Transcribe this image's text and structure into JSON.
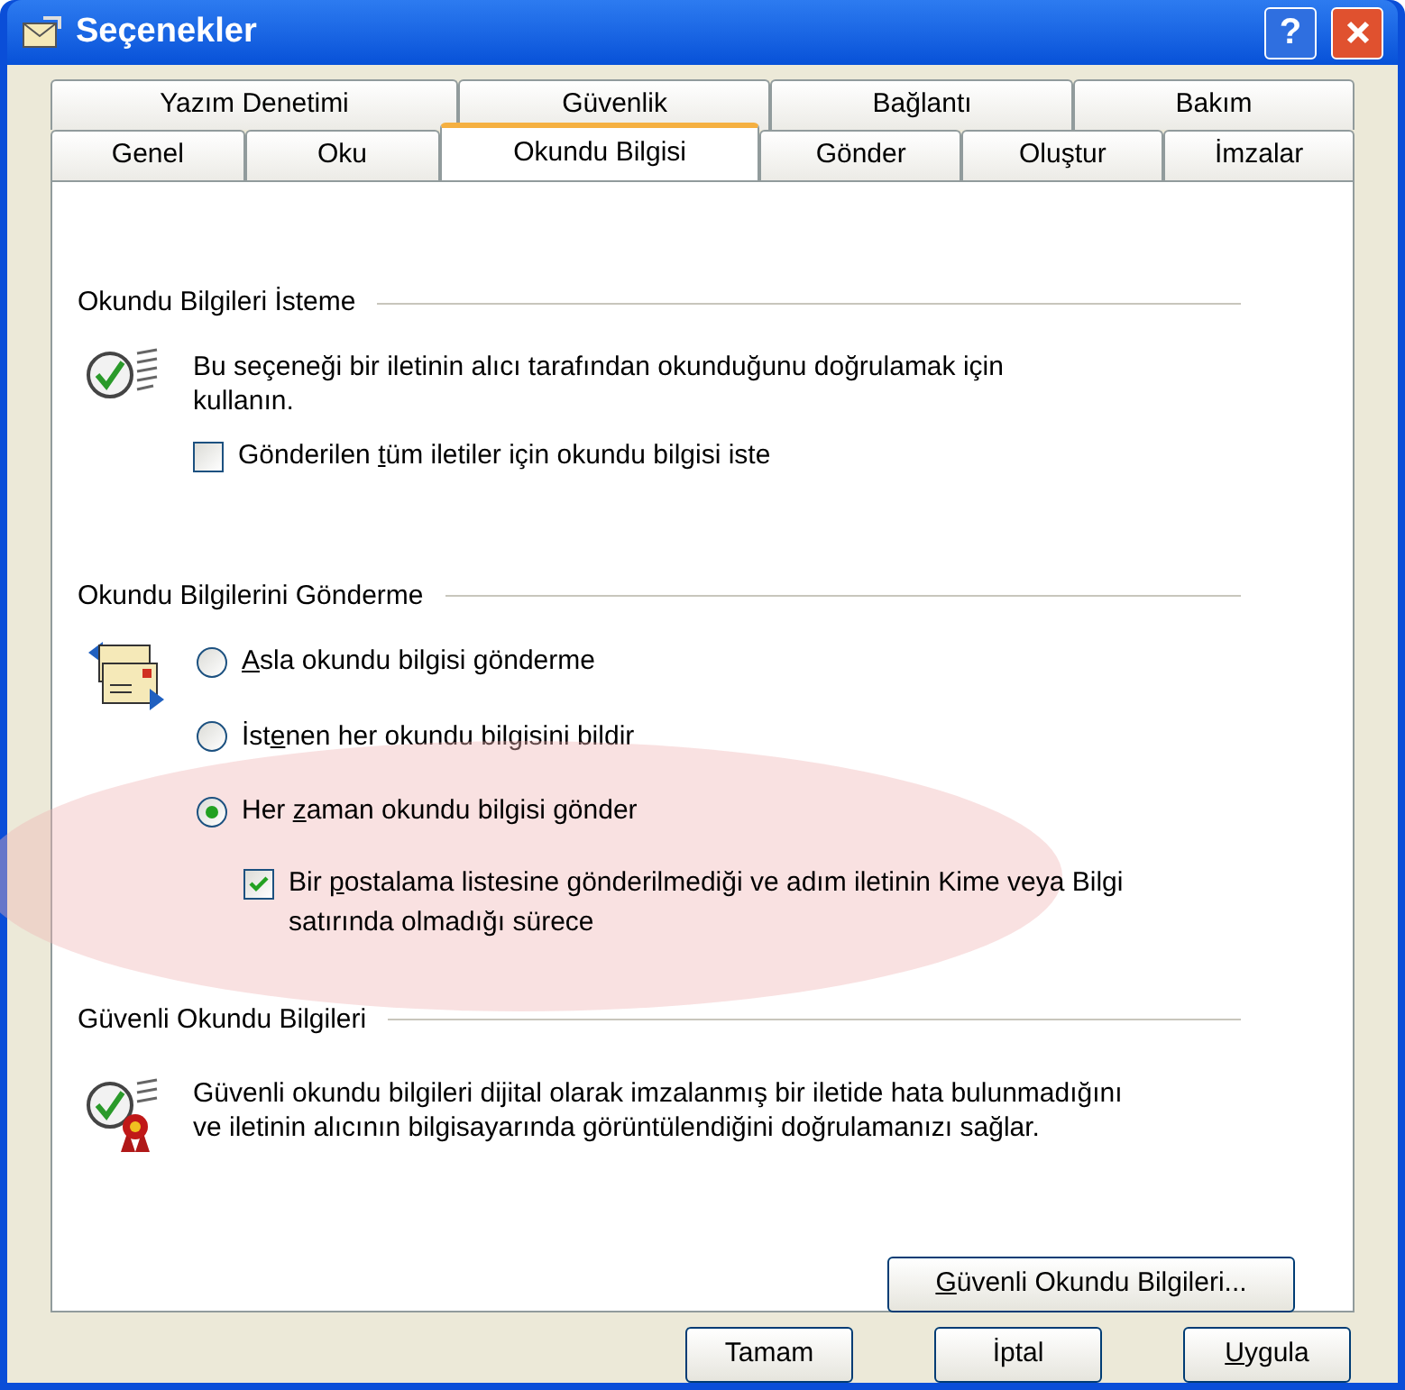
{
  "window": {
    "title": "Seçenekler",
    "help_label": "?"
  },
  "tab_rows": [
    [
      {
        "label": "Yazım Denetimi",
        "selected": false
      },
      {
        "label": "Güvenlik",
        "selected": false
      },
      {
        "label": "Bağlantı",
        "selected": false
      },
      {
        "label": "Bakım",
        "selected": false
      }
    ],
    [
      {
        "label": "Genel",
        "selected": false
      },
      {
        "label": "Oku",
        "selected": false
      },
      {
        "label": "Okundu Bilgisi",
        "selected": true
      },
      {
        "label": "Gönder",
        "selected": false
      },
      {
        "label": "Oluştur",
        "selected": false
      },
      {
        "label": "İmzalar",
        "selected": false
      }
    ]
  ],
  "request": {
    "title": "Okundu Bilgileri İsteme",
    "description": "Bu seçeneği bir iletinin alıcı tarafından okunduğunu doğrulamak için kullanın.",
    "checkbox": {
      "before": "Gönderilen ",
      "key": "t",
      "after": "üm iletiler için okundu bilgisi iste",
      "checked": false
    }
  },
  "send": {
    "title": "Okundu Bilgilerini Gönderme",
    "options": [
      {
        "key": "A",
        "after": "sla okundu bilgisi gönderme",
        "selected": false,
        "highlighted": false
      },
      {
        "before": "İst",
        "key": "e",
        "after": "nen her okundu bilgisini bildir",
        "selected": false,
        "highlighted": false
      },
      {
        "before": "Her ",
        "key": "z",
        "after": "aman okundu bilgisi gönder",
        "selected": true,
        "highlighted": true
      }
    ],
    "checkbox": {
      "before": "Bir ",
      "key": "p",
      "after": "ostalama listesine gönderilmediği ve adım iletinin Kime veya Bilgi satırında olmadığı sürece",
      "checked": true
    }
  },
  "secure": {
    "title": "Güvenli Okundu Bilgileri",
    "description": "Güvenli okundu bilgileri dijital olarak imzalanmış bir iletide hata bulunmadığını ve iletinin alıcının bilgisayarında görüntülendiğini doğrulamanızı sağlar.",
    "button": {
      "key": "G",
      "after": "üvenli Okundu Bilgileri..."
    }
  },
  "buttons": [
    {
      "after": "Tamam"
    },
    {
      "after": "İptal"
    },
    {
      "key": "U",
      "after": "ygula"
    }
  ]
}
